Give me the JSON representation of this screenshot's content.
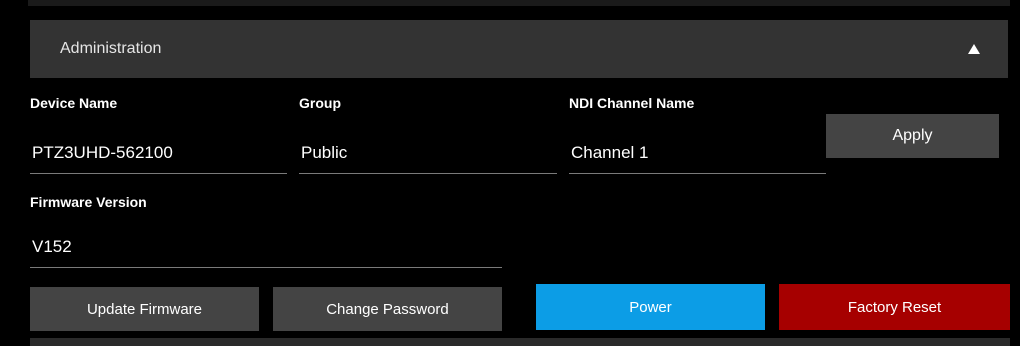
{
  "panel": {
    "title": "Administration"
  },
  "fields": {
    "device_name": {
      "label": "Device Name",
      "value": "PTZ3UHD-562100"
    },
    "group": {
      "label": "Group",
      "value": "Public"
    },
    "ndi_channel_name": {
      "label": "NDI Channel Name",
      "value": "Channel 1"
    },
    "firmware_version": {
      "label": "Firmware Version",
      "value": "V152"
    }
  },
  "buttons": {
    "apply": "Apply",
    "update_firmware": "Update Firmware",
    "change_password": "Change Password",
    "power": "Power",
    "factory_reset": "Factory Reset"
  },
  "icons": {
    "collapse": "triangle-up-icon"
  },
  "colors": {
    "background": "#000000",
    "panel_header": "#333333",
    "button_gray": "#444444",
    "power_button": "#0c9de6",
    "factory_reset_button": "#a60000",
    "input_underline": "#7a7a7a"
  }
}
